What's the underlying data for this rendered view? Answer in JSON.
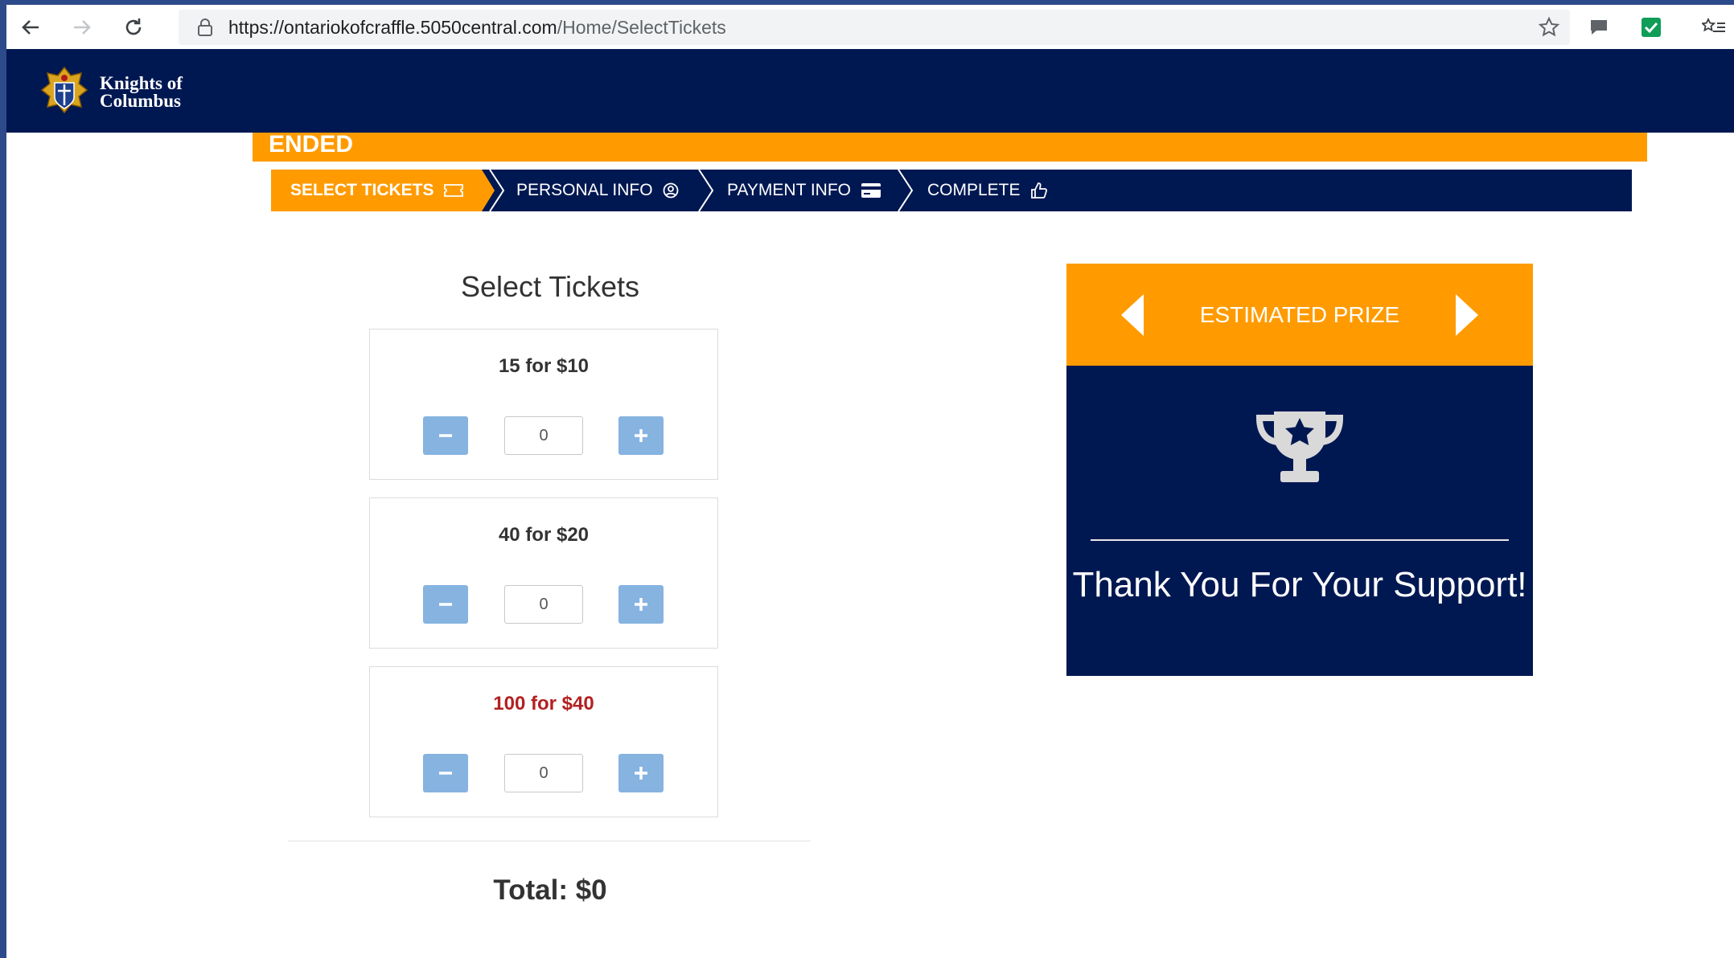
{
  "browser": {
    "url_host": "https://ontariokofcraffle.5050central.com",
    "url_path": "/Home/SelectTickets"
  },
  "brand": {
    "name_line1": "Knights of",
    "name_line2": "Columbus",
    "logo": "knights-of-columbus-emblem"
  },
  "banner": {
    "text": "ENDED"
  },
  "steps": [
    {
      "label": "SELECT TICKETS",
      "icon": "ticket-icon",
      "active": true
    },
    {
      "label": "PERSONAL INFO",
      "icon": "user-circle-icon",
      "active": false
    },
    {
      "label": "PAYMENT INFO",
      "icon": "credit-card-icon",
      "active": false
    },
    {
      "label": "COMPLETE",
      "icon": "thumbs-up-icon",
      "active": false
    }
  ],
  "select": {
    "title": "Select Tickets",
    "options": [
      {
        "label": "15 for $10",
        "quantity": "0"
      },
      {
        "label": "40 for $20",
        "quantity": "0"
      },
      {
        "label": "100 for $40",
        "quantity": "0"
      }
    ],
    "total": "Total: $0"
  },
  "prize": {
    "title": "ESTIMATED PRIZE",
    "icon": "trophy-icon",
    "message": "Thank You For Your Support!"
  },
  "colors": {
    "navy": "#001852",
    "orange": "#ff9b00",
    "button_blue": "#86b3e0",
    "highlight_red": "#b32020"
  }
}
